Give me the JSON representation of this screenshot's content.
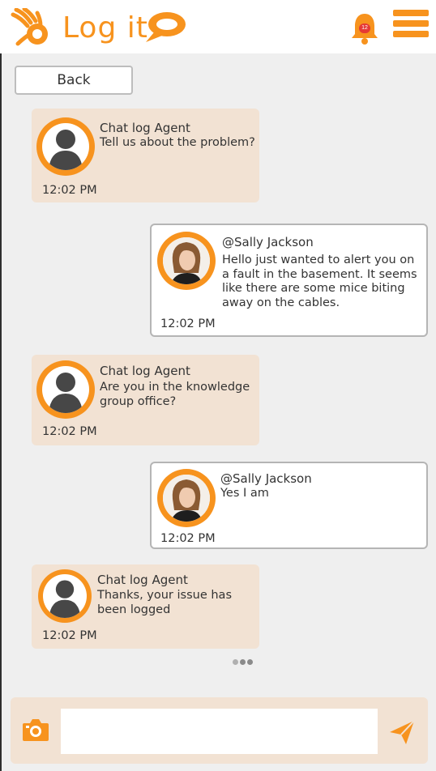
{
  "header": {
    "app_title": "Log it",
    "notification_count": "12",
    "accent_color": "#f7931e"
  },
  "nav": {
    "back_label": "Back"
  },
  "messages": [
    {
      "role": "agent",
      "sender": "Chat log Agent",
      "text": "Tell us about the problem?",
      "time": "12:02 PM"
    },
    {
      "role": "user",
      "sender": "@Sally Jackson",
      "text": "Hello just wanted to alert you on a fault in the basement. It seems like there are some mice biting away on the cables.",
      "time": "12:02 PM"
    },
    {
      "role": "agent",
      "sender": "Chat log Agent",
      "text": "Are you in the knowledge group office?",
      "time": "12:02 PM"
    },
    {
      "role": "user",
      "sender": "@Sally Jackson",
      "text": "Yes I am",
      "time": "12:02 PM"
    },
    {
      "role": "agent",
      "sender": "Chat log Agent",
      "text": "Thanks, your issue has been logged",
      "time": "12:02 PM"
    }
  ],
  "composer": {
    "message_value": "",
    "message_placeholder": "",
    "camera_icon": "camera-icon",
    "send_icon": "send-icon"
  }
}
